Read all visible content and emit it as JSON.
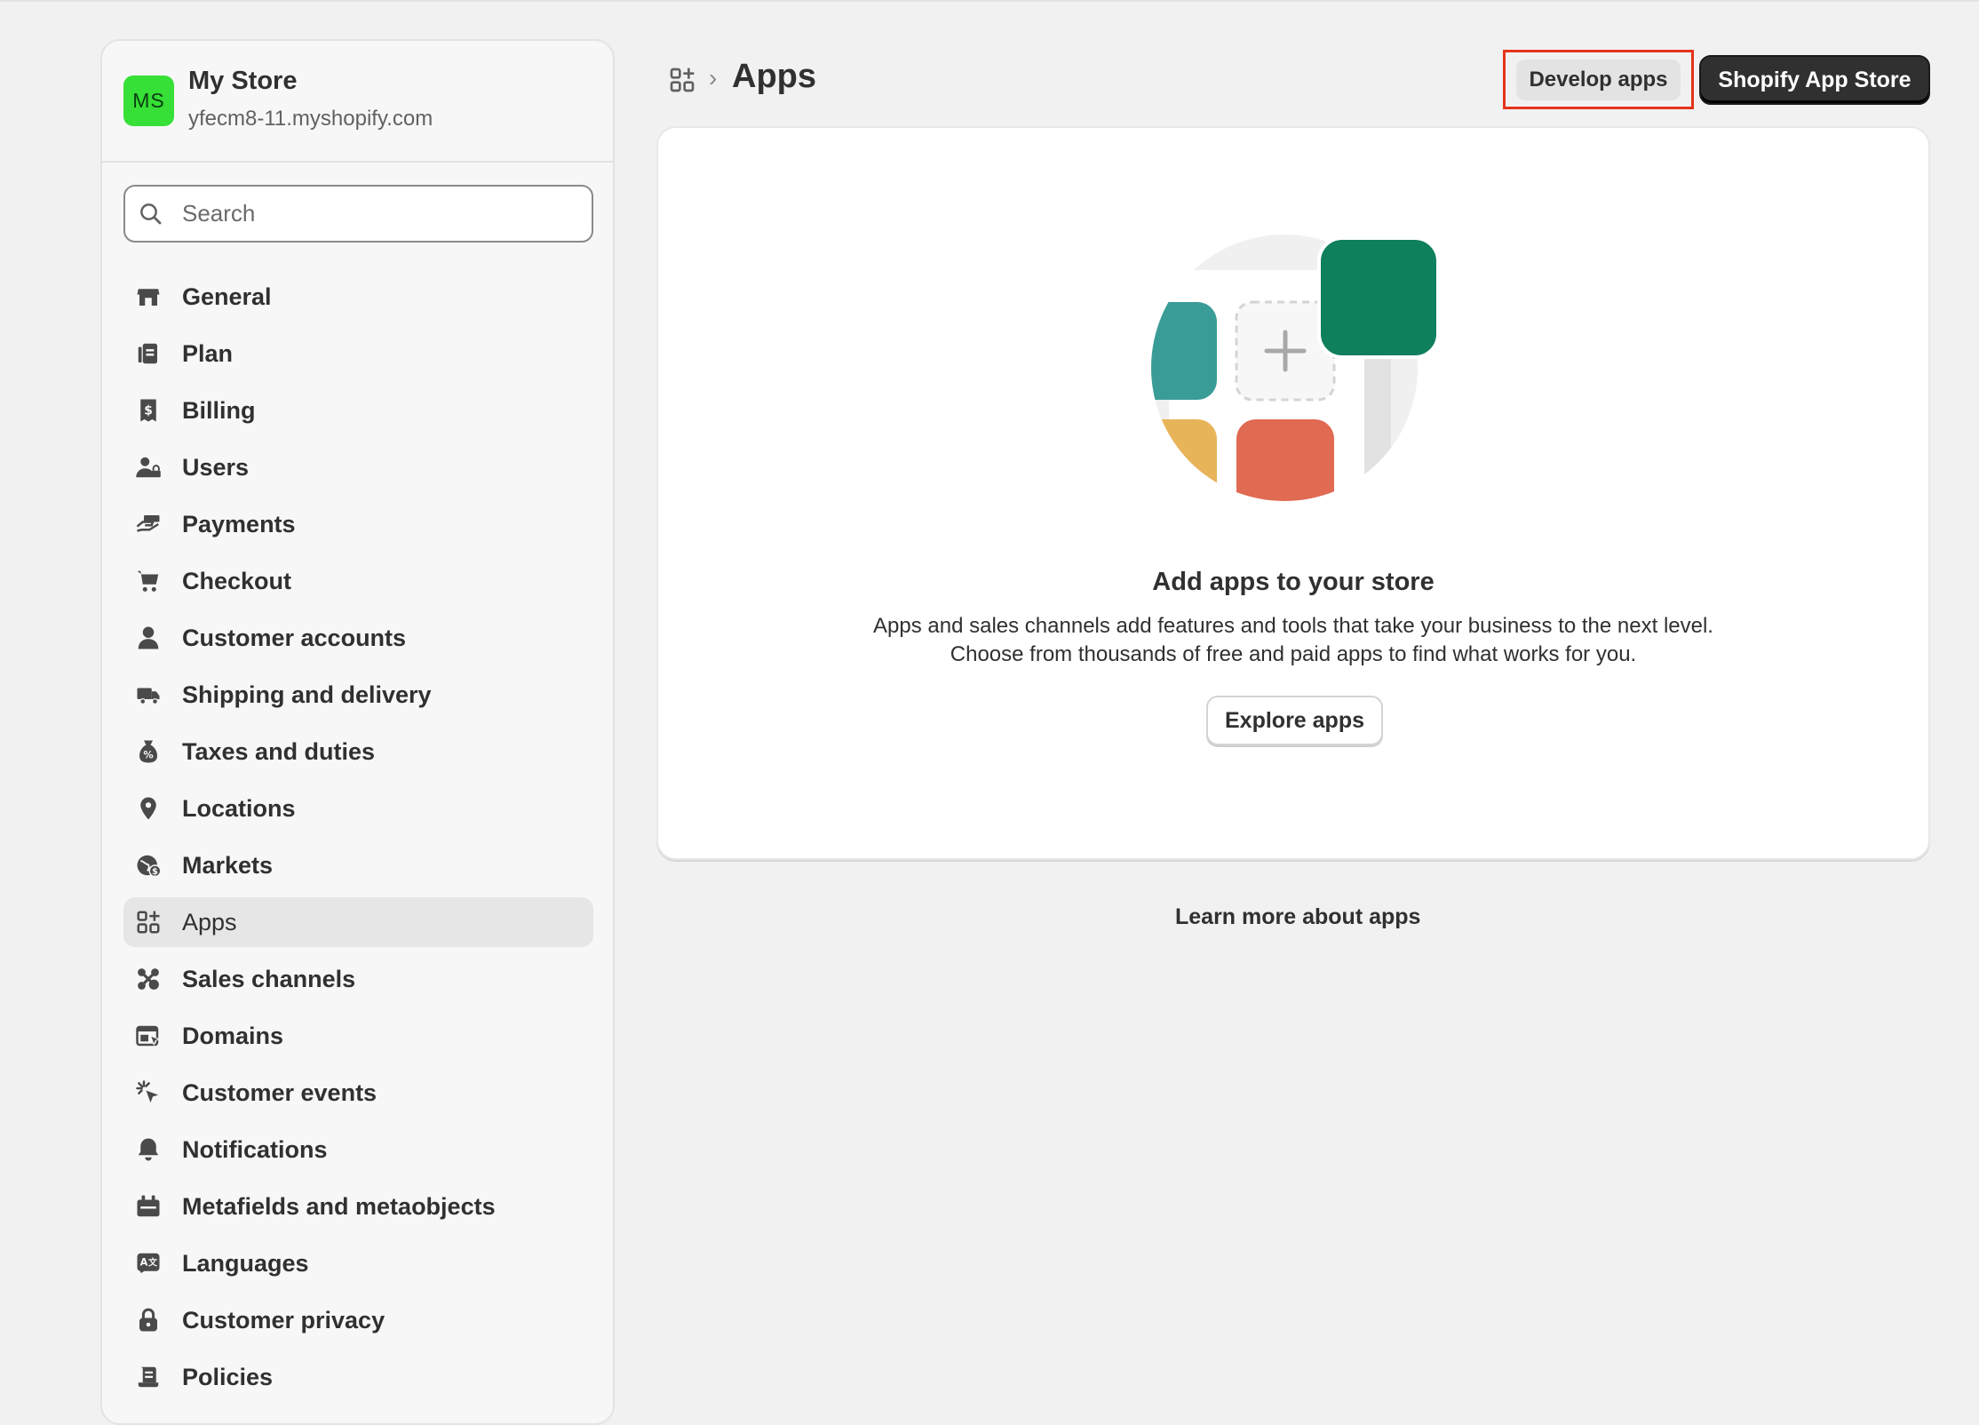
{
  "store": {
    "avatar_initials": "MS",
    "name": "My Store",
    "url": "yfecm8-11.myshopify.com"
  },
  "search": {
    "placeholder": "Search"
  },
  "nav": {
    "items": [
      {
        "label": "General",
        "icon": "store-icon"
      },
      {
        "label": "Plan",
        "icon": "plan-icon"
      },
      {
        "label": "Billing",
        "icon": "billing-icon"
      },
      {
        "label": "Users",
        "icon": "users-icon"
      },
      {
        "label": "Payments",
        "icon": "payments-icon"
      },
      {
        "label": "Checkout",
        "icon": "cart-icon"
      },
      {
        "label": "Customer accounts",
        "icon": "person-icon"
      },
      {
        "label": "Shipping and delivery",
        "icon": "truck-icon"
      },
      {
        "label": "Taxes and duties",
        "icon": "tax-icon"
      },
      {
        "label": "Locations",
        "icon": "location-pin-icon"
      },
      {
        "label": "Markets",
        "icon": "globe-icon"
      },
      {
        "label": "Apps",
        "icon": "apps-icon",
        "active": true
      },
      {
        "label": "Sales channels",
        "icon": "channels-icon"
      },
      {
        "label": "Domains",
        "icon": "domains-icon"
      },
      {
        "label": "Customer events",
        "icon": "cursor-click-icon"
      },
      {
        "label": "Notifications",
        "icon": "bell-icon"
      },
      {
        "label": "Metafields and metaobjects",
        "icon": "metafields-icon"
      },
      {
        "label": "Languages",
        "icon": "language-icon"
      },
      {
        "label": "Customer privacy",
        "icon": "lock-icon"
      },
      {
        "label": "Policies",
        "icon": "policies-icon"
      }
    ]
  },
  "header": {
    "breadcrumb_icon": "apps-icon",
    "title": "Apps",
    "develop_apps_label": "Develop apps",
    "app_store_label": "Shopify App Store"
  },
  "card": {
    "title": "Add apps to your store",
    "desc_line1": "Apps and sales channels add features and tools that take your business to the next level.",
    "desc_line2": "Choose from thousands of free and paid apps to find what works for you.",
    "explore_label": "Explore apps"
  },
  "footer": {
    "learn_more": "Learn more about apps"
  },
  "colors": {
    "accent_dark": "#303030",
    "highlight_border": "#e5341b",
    "avatar_green": "#36e036",
    "illus_teal": "#3a9c97",
    "illus_green": "#11805f",
    "illus_orange": "#e8b45a",
    "illus_red": "#e06a52"
  }
}
